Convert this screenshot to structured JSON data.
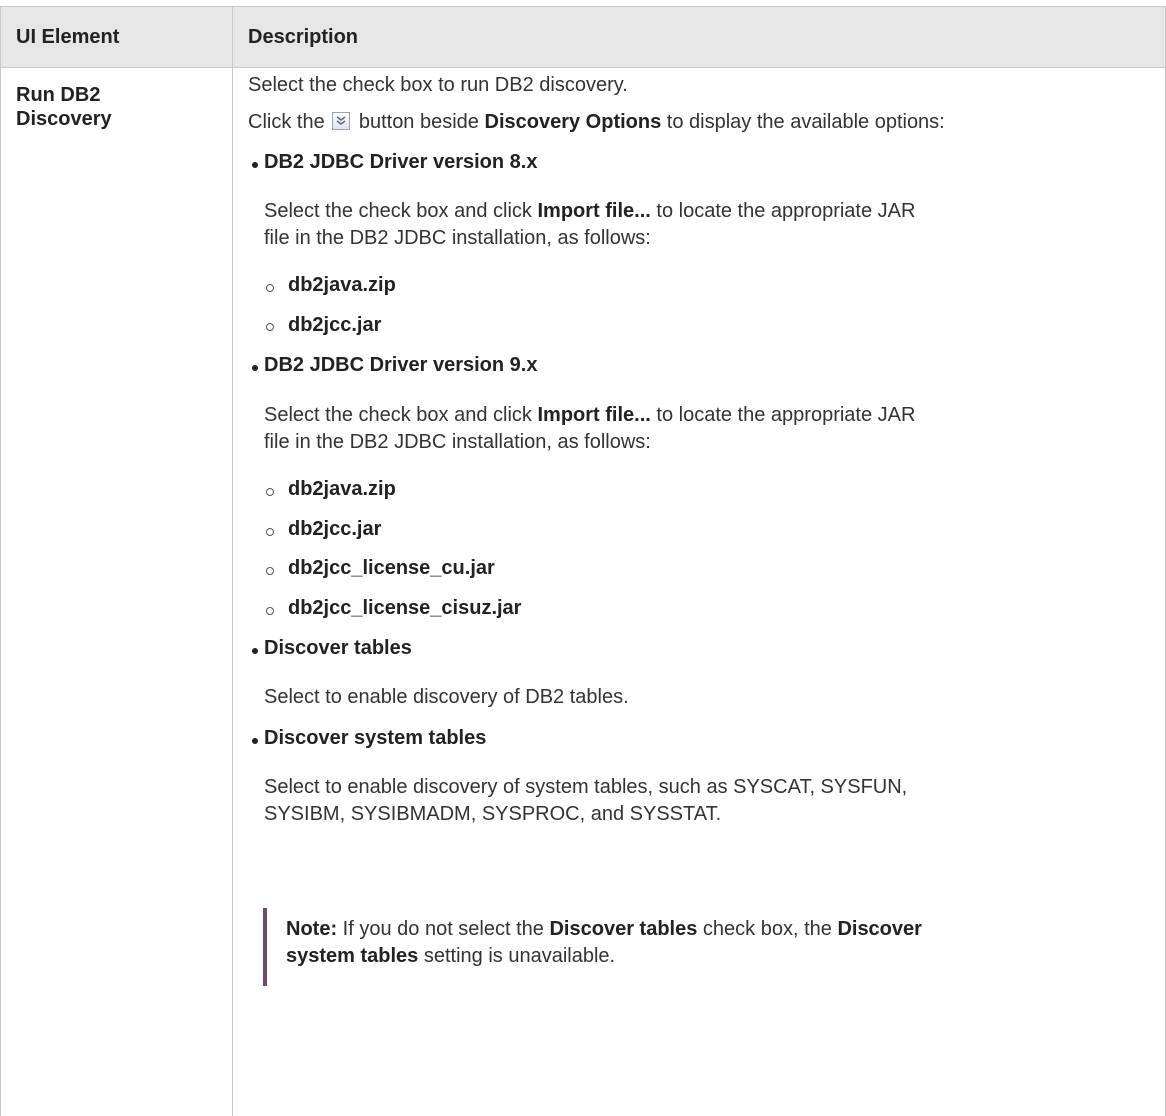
{
  "table": {
    "headers": {
      "col1": "UI Element",
      "col2": "Description"
    },
    "row": {
      "name": "Run DB2 Discovery",
      "intro": "Select the check box to run DB2 discovery.",
      "click_prefix": "Click the",
      "click_mid": "button beside",
      "click_bold": "Discovery Options",
      "click_suffix": "to display the available options:",
      "options": [
        {
          "title": "DB2 JDBC Driver version 8.x",
          "desc_prefix": "Select the check box and click",
          "desc_bold": "Import file...",
          "desc_line1_suffix": "to locate the appropriate JAR",
          "desc_line2": "file in the DB2 JDBC installation, as follows:",
          "files": [
            "db2java.zip",
            "db2jcc.jar"
          ]
        },
        {
          "title": "DB2 JDBC Driver version 9.x",
          "desc_prefix": "Select the check box and click",
          "desc_bold": "Import file...",
          "desc_line1_suffix": "to locate the appropriate JAR",
          "desc_line2": "file in the DB2 JDBC installation, as follows:",
          "files": [
            "db2java.zip",
            "db2jcc.jar",
            "db2jcc_license_cu.jar",
            "db2jcc_license_cisuz.jar"
          ]
        },
        {
          "title": "Discover tables",
          "desc": "Select to enable discovery of DB2 tables."
        },
        {
          "title": "Discover system tables",
          "desc_line1": "Select to enable discovery of system tables, such as SYSCAT, SYSFUN,",
          "desc_line2": "SYSIBM, SYSIBMADM, SYSPROC, and SYSSTAT."
        }
      ],
      "note": {
        "label": "Note:",
        "text1": "If you do not select the",
        "bold1": "Discover tables",
        "text2": "check box, the",
        "bold2_line1": "Discover",
        "bold2_line2": "system tables",
        "text3": "setting is unavailable."
      }
    }
  },
  "icons": {
    "expand_button": "double-chevron-down-icon"
  }
}
